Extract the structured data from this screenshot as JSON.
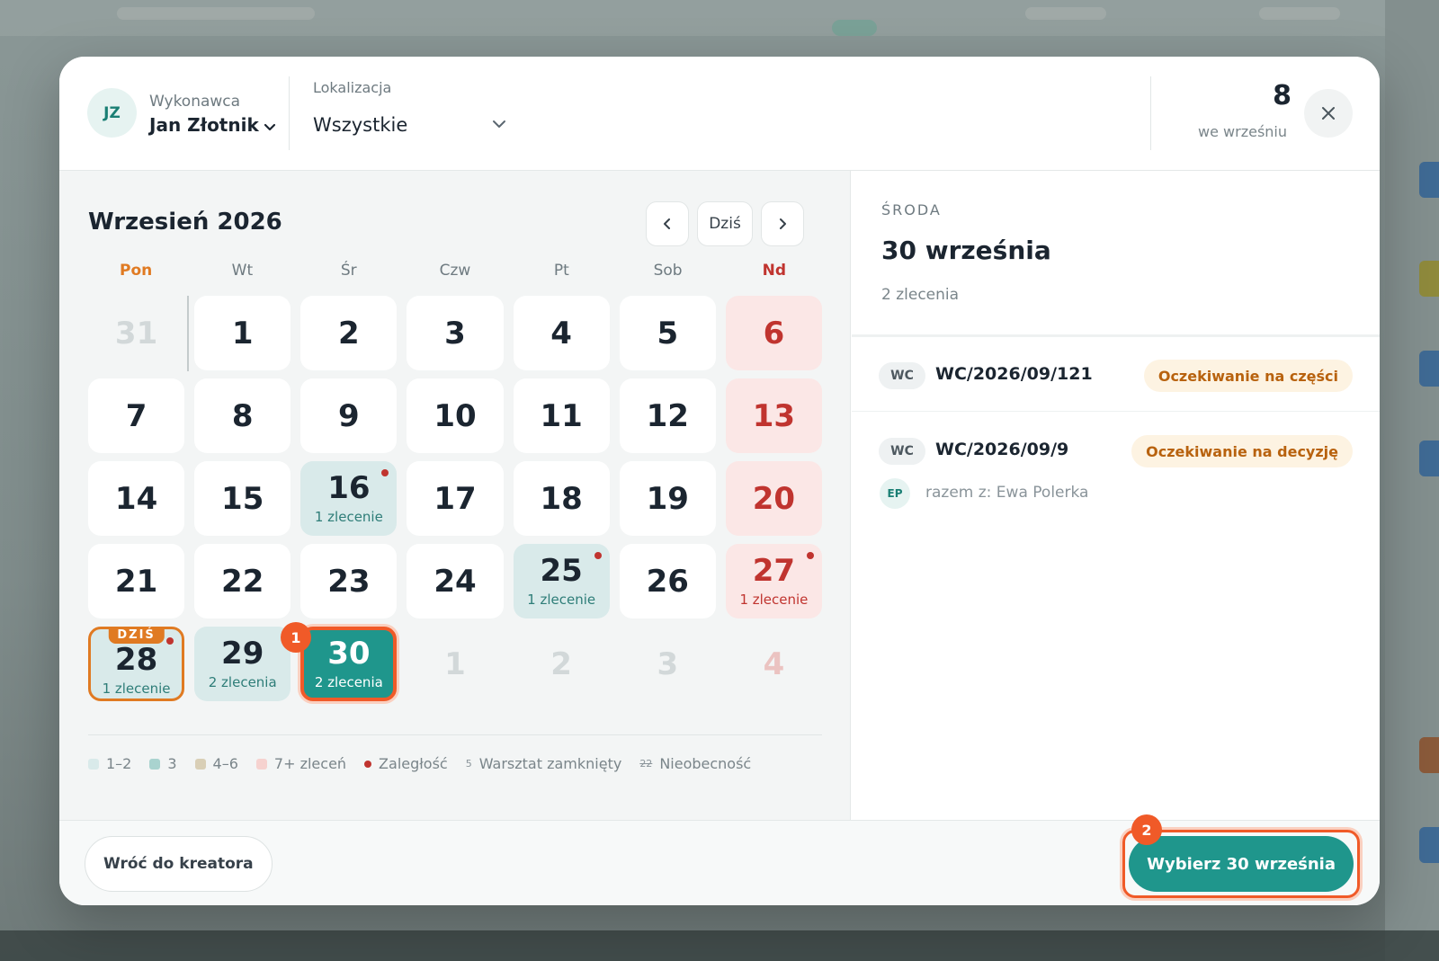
{
  "header": {
    "avatar_initials": "JZ",
    "executor_label": "Wykonawca",
    "executor_name": "Jan Złotnik",
    "location_label": "Lokalizacja",
    "location_value": "Wszystkie",
    "count": "8",
    "count_label": "we wrześniu"
  },
  "calendar": {
    "month_title": "Wrzesień 2026",
    "today_button": "Dziś",
    "weekdays": [
      "Pon",
      "Wt",
      "Śr",
      "Czw",
      "Pt",
      "Sob",
      "Nd"
    ],
    "today_badge": "DZIŚ",
    "days": [
      {
        "n": "31",
        "outside": true
      },
      {
        "n": "1"
      },
      {
        "n": "2"
      },
      {
        "n": "3"
      },
      {
        "n": "4"
      },
      {
        "n": "5"
      },
      {
        "n": "6",
        "sunday": true
      },
      {
        "n": "7"
      },
      {
        "n": "8"
      },
      {
        "n": "9"
      },
      {
        "n": "10"
      },
      {
        "n": "11"
      },
      {
        "n": "12"
      },
      {
        "n": "13",
        "sunday": true
      },
      {
        "n": "14"
      },
      {
        "n": "15"
      },
      {
        "n": "16",
        "sub": "1 zlecenie",
        "lvl": 1,
        "dot": true
      },
      {
        "n": "17"
      },
      {
        "n": "18"
      },
      {
        "n": "19"
      },
      {
        "n": "20",
        "sunday": true
      },
      {
        "n": "21"
      },
      {
        "n": "22"
      },
      {
        "n": "23"
      },
      {
        "n": "24"
      },
      {
        "n": "25",
        "sub": "1 zlecenie",
        "lvl": 1,
        "dot": true
      },
      {
        "n": "26"
      },
      {
        "n": "27",
        "sub": "1 zlecenie",
        "sunday": true,
        "dot": true
      },
      {
        "n": "28",
        "sub": "1 zlecenie",
        "today": true,
        "dot": true
      },
      {
        "n": "29",
        "sub": "2 zlecenia",
        "lvl": 1
      },
      {
        "n": "30",
        "sub": "2 zlecenia",
        "selected": true
      },
      {
        "n": "1",
        "outside": true
      },
      {
        "n": "2",
        "outside": true
      },
      {
        "n": "3",
        "outside": true
      },
      {
        "n": "4",
        "outside": true,
        "sunday": true
      }
    ],
    "legend": [
      {
        "label": "1–2",
        "color": "#d9eaea"
      },
      {
        "label": "3",
        "color": "#a9d3cf"
      },
      {
        "label": "4–6",
        "color": "#d9cfb6"
      },
      {
        "label": "7+ zleceń",
        "color": "#f6d2cf"
      },
      {
        "label": "Zaległość",
        "dot": true
      },
      {
        "label": "Warsztat zamknięty",
        "icon": "5"
      },
      {
        "label": "Nieobecność",
        "icon": "22"
      }
    ]
  },
  "side": {
    "weekday": "ŚRODA",
    "date": "30 września",
    "count": "2 zlecenia",
    "orders": [
      {
        "tag": "WC",
        "id": "WC/2026/09/121",
        "status": "Oczekiwanie na części"
      },
      {
        "tag": "WC",
        "id": "WC/2026/09/9",
        "status": "Oczekiwanie na decyzję",
        "with_initials": "EP",
        "with_text": "razem z: Ewa Polerka"
      }
    ]
  },
  "footer": {
    "back_label": "Wróć do kreatora",
    "pick_label": "Wybierz 30 września"
  },
  "markers": [
    "1",
    "2"
  ]
}
